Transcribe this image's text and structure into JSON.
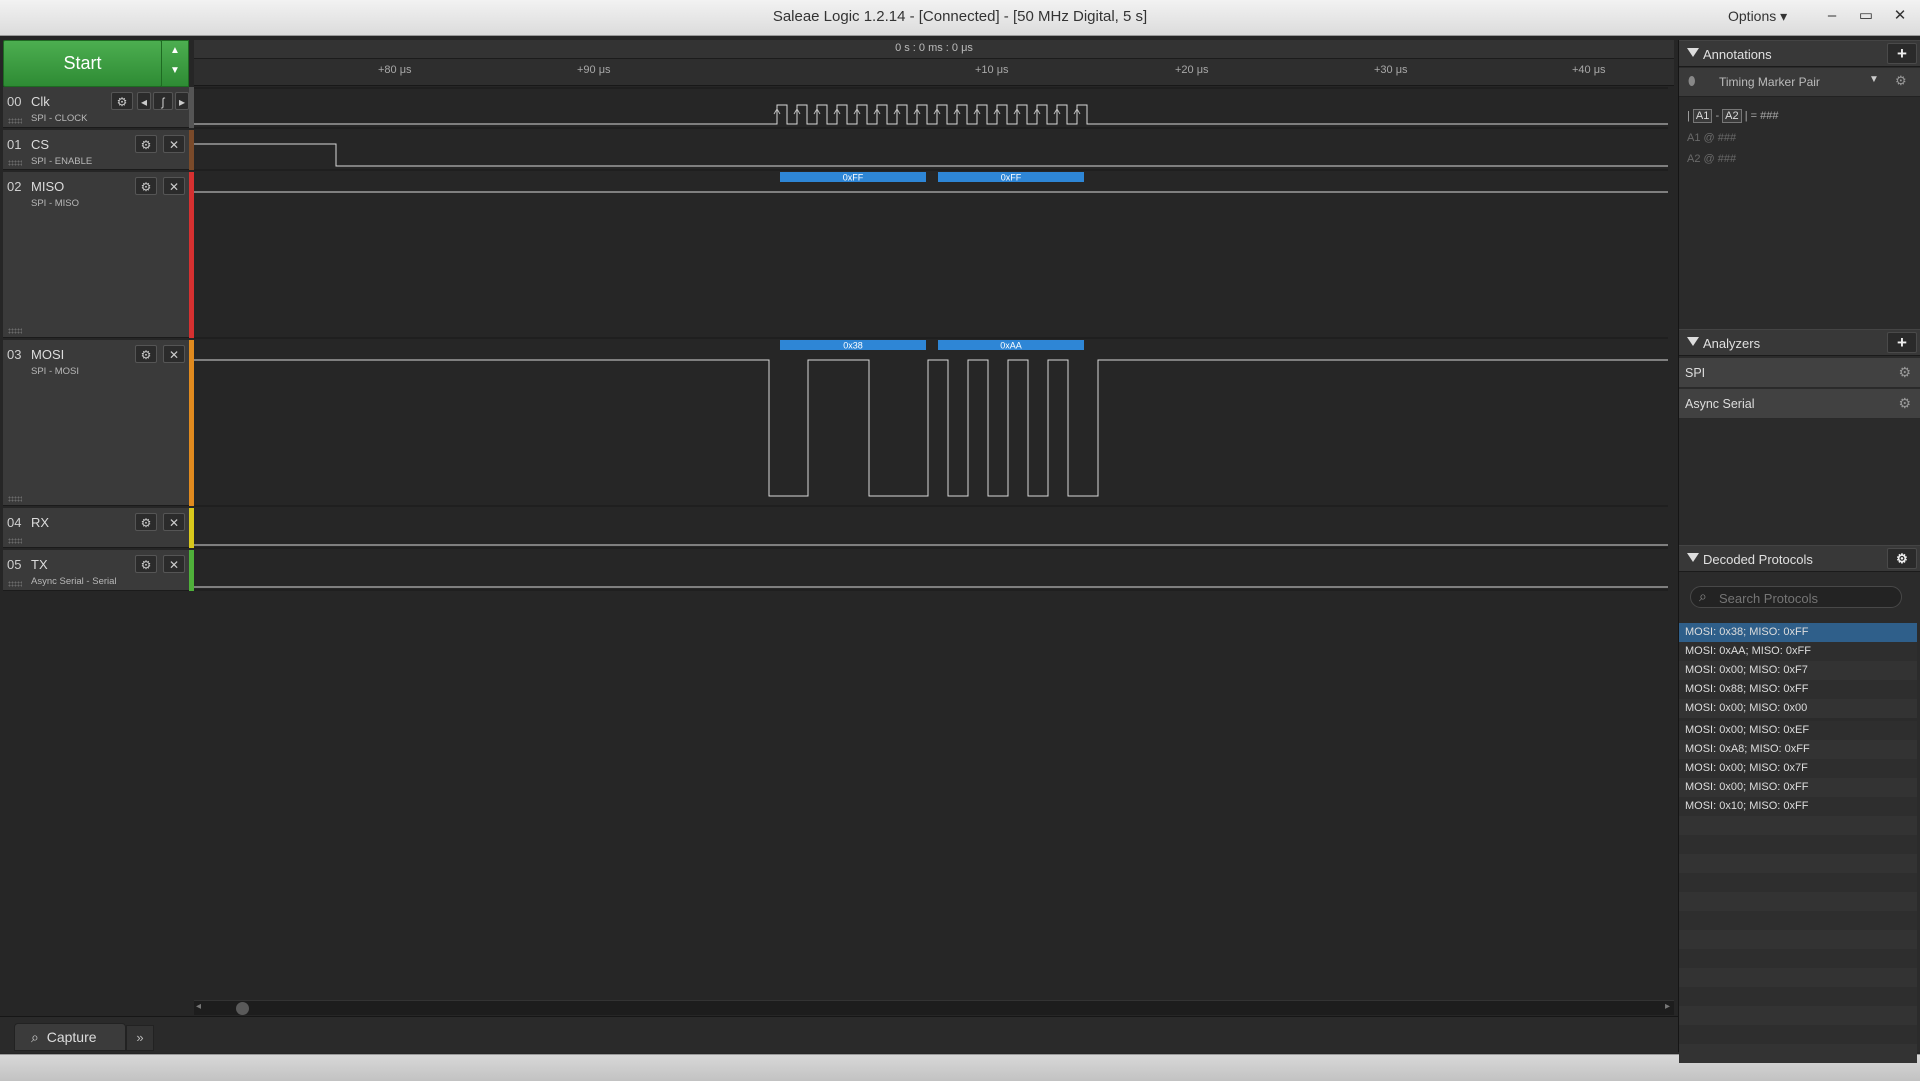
{
  "window": {
    "title": "Saleae Logic 1.2.14 - [Connected] - [50 MHz Digital, 5 s]",
    "options_label": "Options",
    "minimize": "–",
    "restore": "▭",
    "close": "✕"
  },
  "toolbar": {
    "start_label": "Start"
  },
  "ruler": {
    "cursor_time": "0 s : 0 ms : 0 μs",
    "ticks": [
      "+80 μs",
      "+90 μs",
      "+10 μs",
      "+20 μs",
      "+30 μs",
      "+40 μs"
    ]
  },
  "channels": [
    {
      "num": "00",
      "name": "Clk",
      "sub": "SPI - CLOCK",
      "color": "#555555"
    },
    {
      "num": "01",
      "name": "CS",
      "sub": "SPI - ENABLE",
      "color": "#7a4a2a"
    },
    {
      "num": "02",
      "name": "MISO",
      "sub": "SPI - MISO",
      "color": "#d63030"
    },
    {
      "num": "03",
      "name": "MOSI",
      "sub": "SPI - MOSI",
      "color": "#e08a1e"
    },
    {
      "num": "04",
      "name": "RX",
      "sub": "",
      "color": "#d8c81c"
    },
    {
      "num": "05",
      "name": "TX",
      "sub": "Async Serial - Serial",
      "color": "#4fb03a"
    }
  ],
  "decodes": {
    "miso": [
      "0xFF",
      "0xFF"
    ],
    "mosi": [
      "0x38",
      "0xAA"
    ]
  },
  "bottom": {
    "capture_tab": "Capture",
    "more": "»"
  },
  "annotations": {
    "header": "Annotations",
    "marker_type": "Timing Marker Pair",
    "a1": "A1",
    "a2": "A2",
    "diff_value": "= ###",
    "a1_line": "A1  @  ###",
    "a2_line": "A2  @  ###"
  },
  "analyzers": {
    "header": "Analyzers",
    "items": [
      "SPI",
      "Async Serial"
    ]
  },
  "decoded": {
    "header": "Decoded Protocols",
    "search_placeholder": "Search Protocols",
    "rows": [
      "MOSI: 0x38;  MISO: 0xFF",
      "MOSI: 0xAA;  MISO: 0xFF",
      "MOSI: 0x00;  MISO: 0xF7",
      "MOSI: 0x88;  MISO: 0xFF",
      "MOSI: 0x00;  MISO: 0x00",
      "MOSI: 0x00;  MISO: 0xEF",
      "MOSI: 0xA8;  MISO: 0xFF",
      "MOSI: 0x00;  MISO: 0x7F",
      "MOSI: 0x00;  MISO: 0xFF",
      "MOSI: 0x10;  MISO: 0xFF"
    ],
    "selected_index": 0,
    "selected_color": "#2f5f8a"
  },
  "colors": {
    "accent_green": "#3a9d3f",
    "decode_blue": "#2e86d6",
    "trace": "#d8d8d8"
  }
}
